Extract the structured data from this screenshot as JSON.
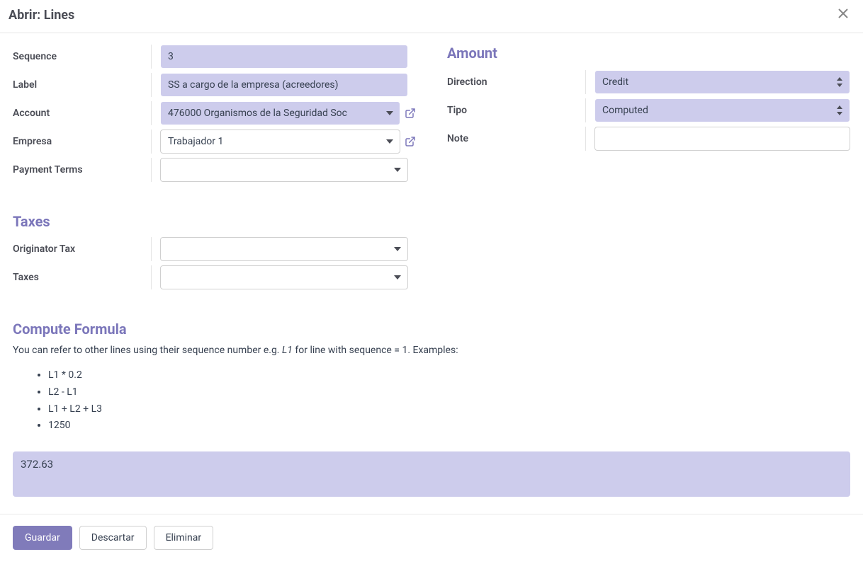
{
  "header": {
    "title": "Abrir: Lines"
  },
  "left": {
    "sequence_label": "Sequence",
    "sequence_value": "3",
    "label_label": "Label",
    "label_value": "SS a cargo de la empresa (acreedores)",
    "account_label": "Account",
    "account_value": "476000 Organismos de la Seguridad Soc",
    "empresa_label": "Empresa",
    "empresa_value": "Trabajador 1",
    "payment_terms_label": "Payment Terms",
    "payment_terms_value": ""
  },
  "right": {
    "section_title": "Amount",
    "direction_label": "Direction",
    "direction_value": "Credit",
    "tipo_label": "Tipo",
    "tipo_value": "Computed",
    "note_label": "Note",
    "note_value": ""
  },
  "taxes": {
    "section_title": "Taxes",
    "originator_label": "Originator Tax",
    "originator_value": "",
    "taxes_label": "Taxes",
    "taxes_value": ""
  },
  "compute": {
    "section_title": "Compute Formula",
    "desc_prefix": "You can refer to other lines using their sequence number e.g. ",
    "desc_em": "L1",
    "desc_suffix": " for line with sequence = 1. Examples:",
    "examples": [
      "L1 * 0.2",
      "L2 - L1",
      "L1 + L2 + L3",
      "1250"
    ],
    "formula_value": "372.63"
  },
  "footer": {
    "save": "Guardar",
    "discard": "Descartar",
    "delete": "Eliminar"
  }
}
